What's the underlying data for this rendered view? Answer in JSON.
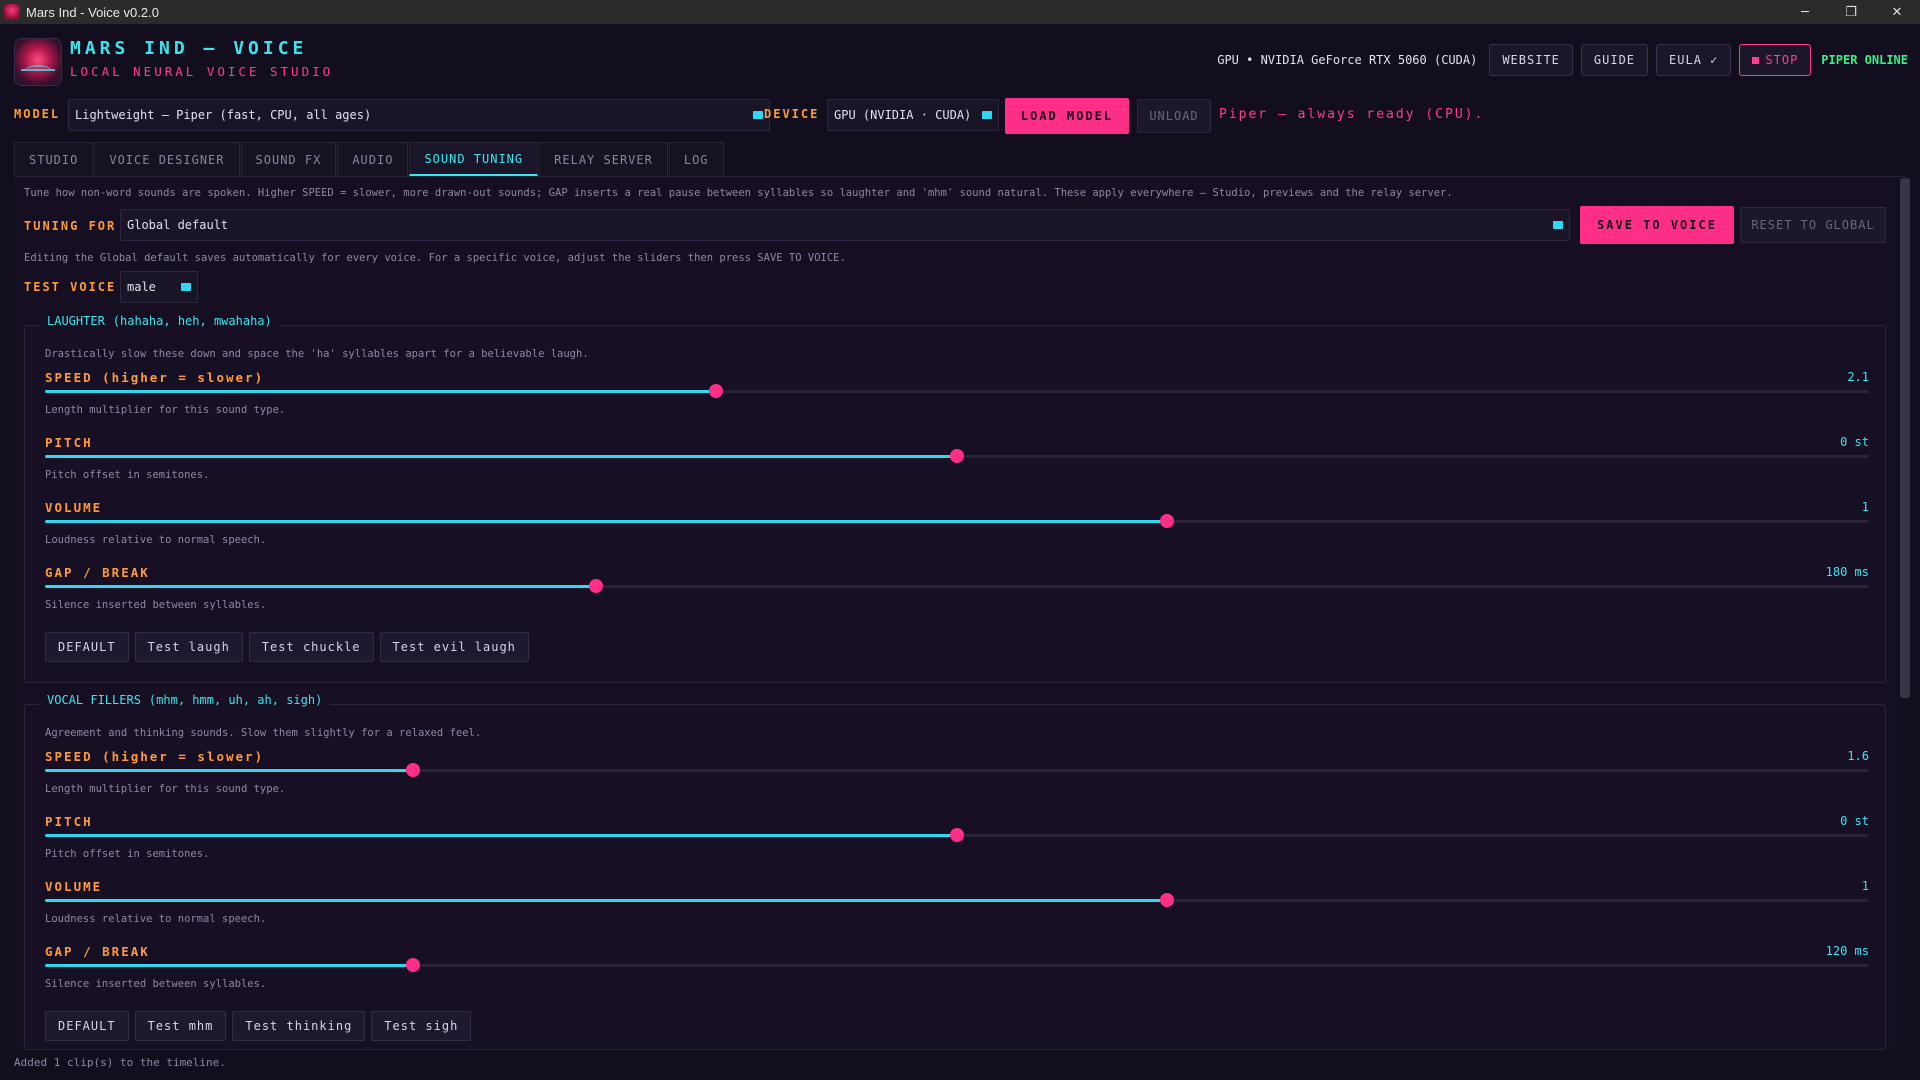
{
  "window": {
    "title": "Mars Ind - Voice v0.2.0",
    "controls": [
      "─",
      "❐",
      "✕"
    ]
  },
  "header": {
    "brand_title": "MARS IND — VOICE",
    "brand_subtitle": "LOCAL NEURAL VOICE STUDIO",
    "gpu_info": "GPU • NVIDIA GeForce RTX 5060 (CUDA)",
    "website_label": "WEBSITE",
    "guide_label": "GUIDE",
    "eula_label": "EULA ✓",
    "stop_label": "STOP",
    "engine_status": "PIPER ONLINE"
  },
  "model_row": {
    "model_label": "MODEL",
    "model_value": "Lightweight — Piper  (fast, CPU, all ages)",
    "device_label": "DEVICE",
    "device_value": "GPU (NVIDIA · CUDA)",
    "load_label": "LOAD MODEL",
    "unload_label": "UNLOAD",
    "status_text": "Piper — always ready (CPU)."
  },
  "tabs": [
    {
      "label": "STUDIO",
      "active": false
    },
    {
      "label": "VOICE DESIGNER",
      "active": false
    },
    {
      "label": "SOUND FX",
      "active": false
    },
    {
      "label": "AUDIO",
      "active": false
    },
    {
      "label": "SOUND TUNING",
      "active": true
    },
    {
      "label": "RELAY SERVER",
      "active": false
    },
    {
      "label": "LOG",
      "active": false
    }
  ],
  "tuning": {
    "intro": "Tune how non-word sounds are spoken. Higher SPEED = slower, more drawn-out sounds; GAP inserts a real pause between syllables so laughter and 'mhm' sound natural. These apply everywhere — Studio, previews and the relay server.",
    "tuning_for_label": "TUNING FOR",
    "tuning_for_value": "Global default",
    "save_label": "SAVE TO VOICE",
    "reset_label": "RESET TO GLOBAL",
    "editing_note": "Editing the Global default saves automatically for every voice. For a specific voice, adjust the sliders then press SAVE TO VOICE.",
    "test_voice_label": "TEST VOICE",
    "test_voice_value": "male"
  },
  "groups": [
    {
      "title": "LAUGHTER",
      "hint": "(hahaha, heh, mwahaha)",
      "description": "Drastically slow these down and space the 'ha' syllables apart for a believable laugh.",
      "sliders": [
        {
          "label": "SPEED (higher = slower)",
          "value": "2.1",
          "fraction": 0.368,
          "desc": "Length multiplier for this sound type."
        },
        {
          "label": "PITCH",
          "value": "0 st",
          "fraction": 0.5,
          "desc": "Pitch offset in semitones."
        },
        {
          "label": "VOLUME",
          "value": "1",
          "fraction": 0.615,
          "desc": "Loudness relative to normal speech."
        },
        {
          "label": "GAP / BREAK",
          "value": "180 ms",
          "fraction": 0.302,
          "desc": "Silence inserted between syllables."
        }
      ],
      "buttons": [
        "DEFAULT",
        "Test laugh",
        "Test chuckle",
        "Test evil laugh"
      ]
    },
    {
      "title": "VOCAL FILLERS",
      "hint": "(mhm, hmm, uh, ah, sigh)",
      "description": "Agreement and thinking sounds. Slow them slightly for a relaxed feel.",
      "sliders": [
        {
          "label": "SPEED (higher = slower)",
          "value": "1.6",
          "fraction": 0.202,
          "desc": "Length multiplier for this sound type."
        },
        {
          "label": "PITCH",
          "value": "0 st",
          "fraction": 0.5,
          "desc": "Pitch offset in semitones."
        },
        {
          "label": "VOLUME",
          "value": "1",
          "fraction": 0.615,
          "desc": "Loudness relative to normal speech."
        },
        {
          "label": "GAP / BREAK",
          "value": "120 ms",
          "fraction": 0.202,
          "desc": "Silence inserted between syllables."
        }
      ],
      "buttons": [
        "DEFAULT",
        "Test mhm",
        "Test thinking",
        "Test sigh"
      ]
    }
  ],
  "footer": {
    "status": "Added 1 clip(s) to the timeline."
  },
  "colors": {
    "accent_cyan": "#3be5f0",
    "accent_pink": "#ff2f87",
    "label_orange": "#ff9a3c",
    "online_green": "#35f08a"
  }
}
